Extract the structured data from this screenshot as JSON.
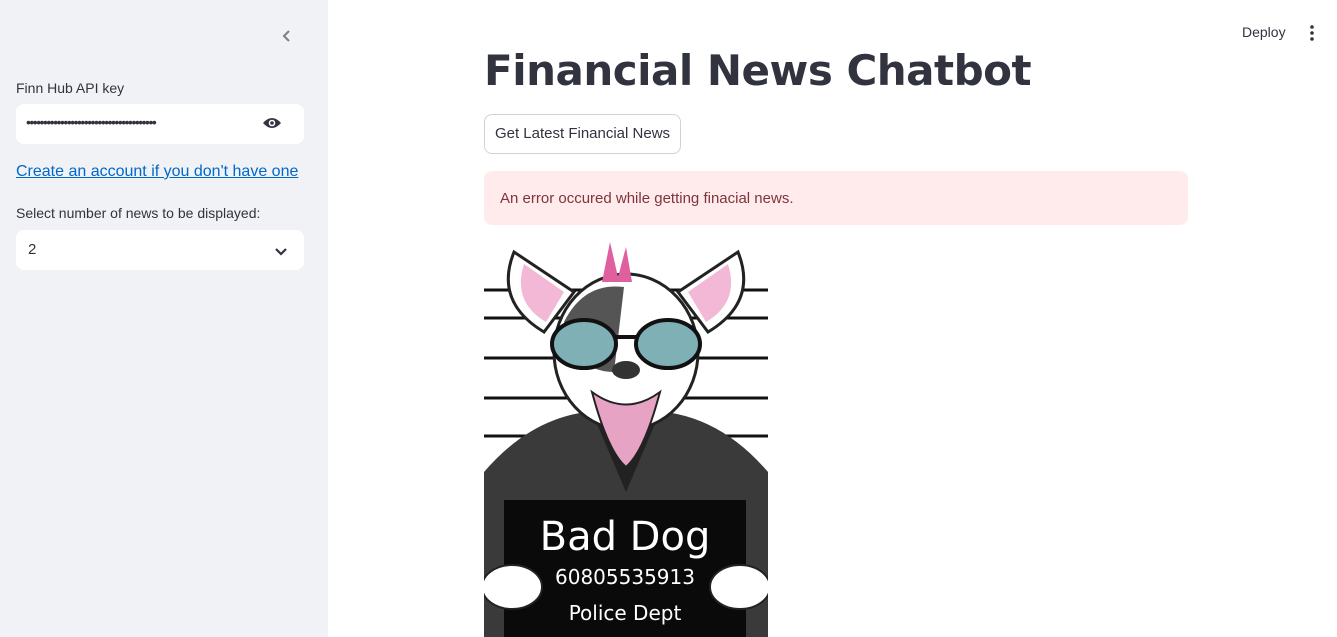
{
  "sidebar": {
    "api_key_label": "Finn Hub API key",
    "api_key_value": "••••••••••••••••••••••••••••••••••••••",
    "create_account_link": "Create an account if you don't have one",
    "select_label": "Select number of news to be displayed:",
    "select_value": "2"
  },
  "header": {
    "deploy_label": "Deploy"
  },
  "main": {
    "title": "Financial News Chatbot",
    "get_news_button": "Get Latest Financial News",
    "error_message": "An error occured while getting finacial news.",
    "image": {
      "sign_title": "Bad Dog",
      "sign_number": "60805535913",
      "sign_footer": "Police Dept"
    }
  },
  "colors": {
    "sidebar_bg": "#f0f2f6",
    "link": "#0068c9",
    "error_bg": "#ffebeb",
    "error_text": "#7d353b"
  }
}
